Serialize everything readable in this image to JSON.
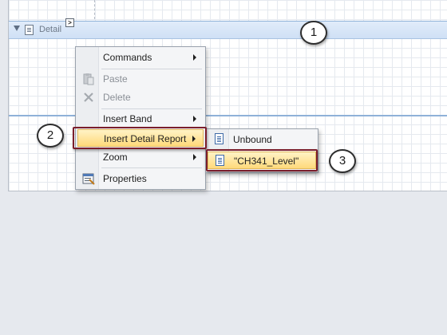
{
  "band": {
    "label": "Detail",
    "smart_tag_glyph": ">"
  },
  "callouts": [
    "1",
    "2",
    "3"
  ],
  "context_menu": {
    "items": [
      {
        "label": "Commands",
        "has_submenu": true,
        "disabled": false,
        "icon": "none"
      },
      {
        "label": "Paste",
        "has_submenu": false,
        "disabled": true,
        "icon": "paste-icon"
      },
      {
        "label": "Delete",
        "has_submenu": false,
        "disabled": true,
        "icon": "delete-icon"
      },
      {
        "label": "Insert Band",
        "has_submenu": true,
        "disabled": false,
        "icon": "none"
      },
      {
        "label": "Insert Detail Report",
        "has_submenu": true,
        "disabled": false,
        "highlighted": true,
        "icon": "none"
      },
      {
        "label": "Zoom",
        "has_submenu": true,
        "disabled": false,
        "icon": "none"
      },
      {
        "label": "Properties",
        "has_submenu": false,
        "disabled": false,
        "icon": "properties-icon"
      }
    ]
  },
  "submenu": {
    "items": [
      {
        "label": "Unbound",
        "icon": "report-icon"
      },
      {
        "label": "\"CH341_Level\"",
        "icon": "report-icon",
        "highlighted": true
      }
    ]
  },
  "colors": {
    "highlight_frame": "#7b1e2c",
    "menu_highlight": "#ffd97a",
    "band_header": "#cfe0f5"
  }
}
